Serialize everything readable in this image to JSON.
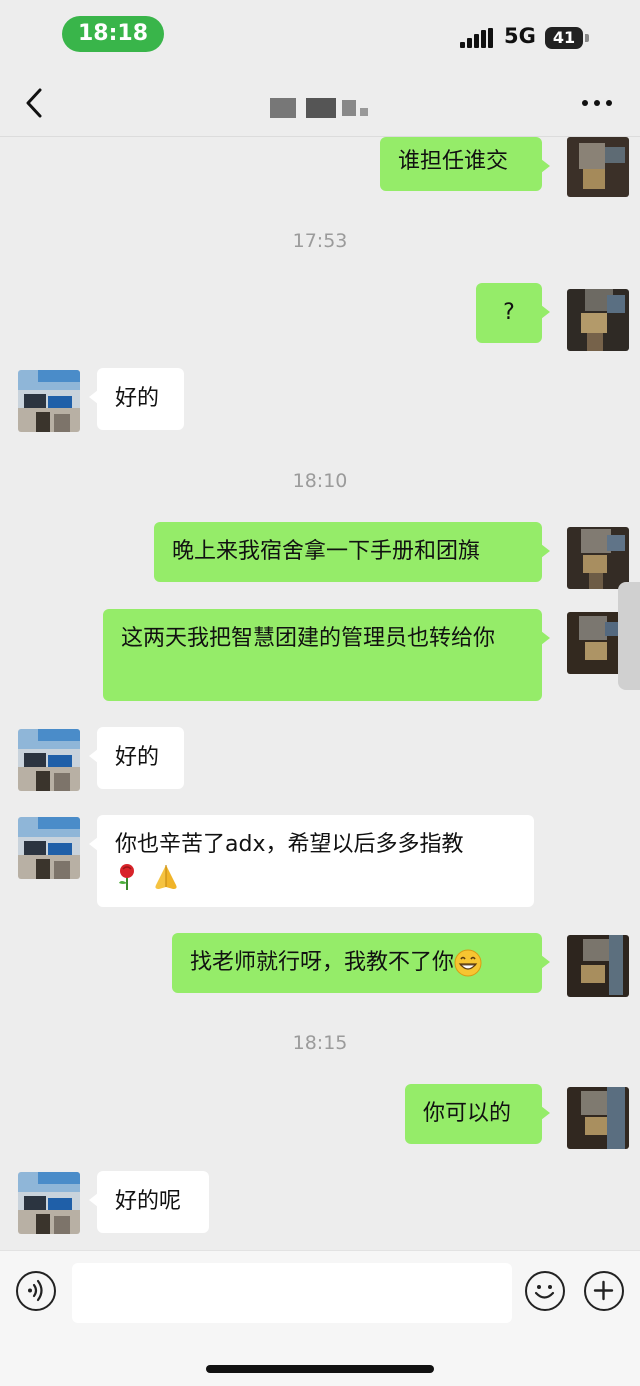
{
  "status_bar": {
    "time": "18:18",
    "network": "5G",
    "battery": "41"
  },
  "nav": {
    "back_icon": "chevron-left-icon",
    "more_icon": "more-dots-icon"
  },
  "messages": [
    {
      "type": "out",
      "text": "谁担任谁交"
    },
    {
      "type": "time",
      "text": "17:53"
    },
    {
      "type": "out",
      "text": "?"
    },
    {
      "type": "in",
      "text": "好的"
    },
    {
      "type": "time",
      "text": "18:10"
    },
    {
      "type": "out",
      "text": "晚上来我宿舍拿一下手册和团旗"
    },
    {
      "type": "out",
      "text": "这两天我把智慧团建的管理员也转给你"
    },
    {
      "type": "in",
      "text": "好的"
    },
    {
      "type": "in",
      "text": "你也辛苦了adx，希望以后多多指教",
      "emoji": [
        "rose-icon",
        "praying-hands-icon"
      ]
    },
    {
      "type": "out",
      "text": "找老师就行呀，我教不了你",
      "emoji": [
        "grinning-face-icon"
      ]
    },
    {
      "type": "time",
      "text": "18:15"
    },
    {
      "type": "out",
      "text": "你可以的"
    },
    {
      "type": "in",
      "text": "好的呢"
    }
  ],
  "input_bar": {
    "voice_icon": "voice-icon",
    "emoji_icon": "emoji-icon",
    "plus_icon": "plus-icon",
    "input_value": ""
  },
  "colors": {
    "outgoing_bubble": "#95ec69",
    "incoming_bubble": "#ffffff",
    "background": "#ededed",
    "time_pill": "#39b54a"
  }
}
